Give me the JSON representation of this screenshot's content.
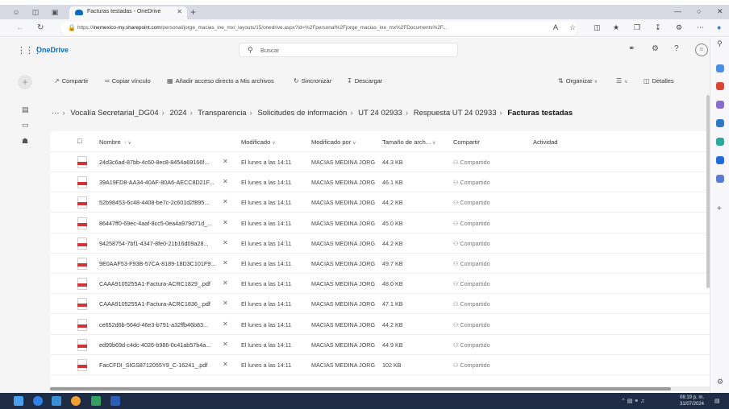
{
  "browser": {
    "tab_title": "Facturas testadas - OneDrive",
    "url_prefix": "https://",
    "url_host": "inemexico-my.sharepoint.com",
    "url_rest": "/personal/jorge_macias_ine_mx/_layouts/15/onedrive.aspx?id=%2Fpersonal%2Fjorge_macias_ine_mx%2FDocuments%2F..."
  },
  "onedrive": {
    "brand": "OneDrive",
    "search_placeholder": "Buscar"
  },
  "commands": {
    "share": "Compartir",
    "copy_link": "Copiar vínculo",
    "add_shortcut": "Añadir acceso directo a Mis archivos",
    "sync": "Sincronizar",
    "download": "Descargar",
    "organize": "Organizar",
    "details": "Detalles"
  },
  "breadcrumb": {
    "ellipsis": "···",
    "items": [
      "Vocalía Secretarial_DG04",
      "2024",
      "Transparencia",
      "Solicitudes de información",
      "UT 24 02933",
      "Respuesta UT 24 02933"
    ],
    "current": "Facturas testadas"
  },
  "columns": {
    "name": "Nombre",
    "modified": "Modificado",
    "modified_by": "Modificado por",
    "size": "Tamaño de arch...",
    "sharing": "Compartir",
    "activity": "Actividad"
  },
  "files": [
    {
      "name": "24d3c6ad-87bb-4c60-8ec8-8454a69166f...",
      "modified": "El lunes a las 14:11",
      "by": "MACIAS MEDINA JORG",
      "size": "44.3 KB",
      "sharing": "Compartido"
    },
    {
      "name": "39A19FD8-AA34-40AF-80A6-AECC8D21F...",
      "modified": "El lunes a las 14:11",
      "by": "MACIAS MEDINA JORG",
      "size": "46.1 KB",
      "sharing": "Compartido"
    },
    {
      "name": "52b98453-6c48-4408-be7c-2c601d2f895...",
      "modified": "El lunes a las 14:11",
      "by": "MACIAS MEDINA JORG",
      "size": "44.2 KB",
      "sharing": "Compartido"
    },
    {
      "name": "86447ff0-69ec-4aaf-8cc5-0ea4a979d71d_...",
      "modified": "El lunes a las 14:11",
      "by": "MACIAS MEDINA JORG",
      "size": "45.0 KB",
      "sharing": "Compartido"
    },
    {
      "name": "94258754-7bf1-4347-8fe0-21b16d09a28...",
      "modified": "El lunes a las 14:11",
      "by": "MACIAS MEDINA JORG",
      "size": "44.2 KB",
      "sharing": "Compartido"
    },
    {
      "name": "9E0AAF53-F93B-57CA-8189-18D3C101F9...",
      "modified": "El lunes a las 14:11",
      "by": "MACIAS MEDINA JORG",
      "size": "49.7 KB",
      "sharing": "Compartido"
    },
    {
      "name": "CAAA9105255A1-Factura-ACRC1829_.pdf",
      "modified": "El lunes a las 14:11",
      "by": "MACIAS MEDINA JORG",
      "size": "48.0 KB",
      "sharing": "Compartido"
    },
    {
      "name": "CAAA9105255A1-Factura-ACRC1836_.pdf",
      "modified": "El lunes a las 14:11",
      "by": "MACIAS MEDINA JORG",
      "size": "47.1 KB",
      "sharing": "Compartido"
    },
    {
      "name": "ce652d6b-564d-46e3-b791-a32ffb46b83...",
      "modified": "El lunes a las 14:11",
      "by": "MACIAS MEDINA JORG",
      "size": "44.2 KB",
      "sharing": "Compartido"
    },
    {
      "name": "ed99b69d-c4dc-4026-b986-0c41ab57b4a...",
      "modified": "El lunes a las 14:11",
      "by": "MACIAS MEDINA JORG",
      "size": "44.9 KB",
      "sharing": "Compartido"
    },
    {
      "name": "FacCFDI_SIGS8712055Y9_C-16241_.pdf",
      "modified": "El lunes a las 14:11",
      "by": "MACIAS MEDINA JORG",
      "size": "102 KB",
      "sharing": "Compartido"
    }
  ],
  "taskbar": {
    "time": "06:19 p. m.",
    "date": "31/07/2024"
  },
  "colors": {
    "accent": "#0f6cbd",
    "pdf_red": "#d13438",
    "taskbar": "#1d2b44"
  }
}
